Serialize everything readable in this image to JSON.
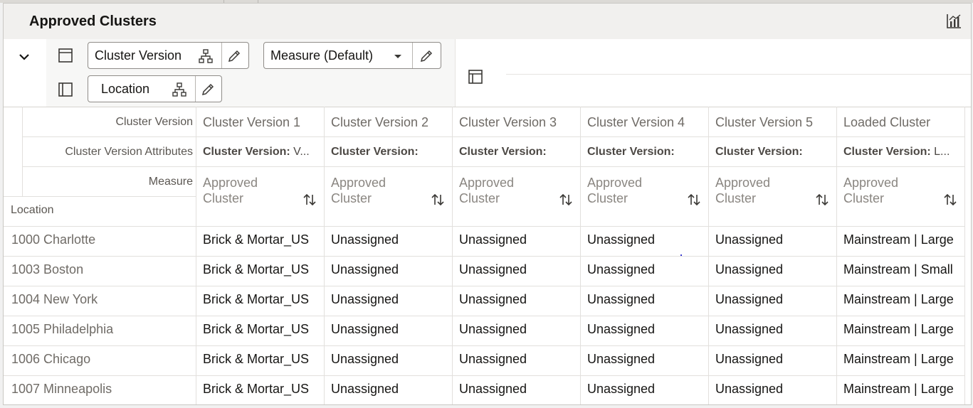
{
  "title": "Approved Clusters",
  "pivot": {
    "columns_chips": [
      {
        "label": "Cluster Version",
        "kind": "hierarchy"
      },
      {
        "label": "Measure (Default)",
        "kind": "dropdown"
      }
    ],
    "rows_chips": [
      {
        "label": "Location",
        "kind": "hierarchy"
      }
    ]
  },
  "grid": {
    "header_labels": {
      "cluster_version": "Cluster Version",
      "attributes": "Cluster Version Attributes",
      "measure": "Measure",
      "location": "Location"
    },
    "columns": [
      {
        "name": "Cluster Version 1",
        "attr_key": "Cluster Version:",
        "attr_val": " V...",
        "measure_line1": "Approved",
        "measure_line2": "Cluster"
      },
      {
        "name": "Cluster Version 2",
        "attr_key": "Cluster Version:",
        "attr_val": "",
        "measure_line1": "Approved",
        "measure_line2": "Cluster"
      },
      {
        "name": "Cluster Version 3",
        "attr_key": "Cluster Version:",
        "attr_val": "",
        "measure_line1": "Approved",
        "measure_line2": "Cluster"
      },
      {
        "name": "Cluster Version 4",
        "attr_key": "Cluster Version:",
        "attr_val": "",
        "measure_line1": "Approved",
        "measure_line2": "Cluster"
      },
      {
        "name": "Cluster Version 5",
        "attr_key": "Cluster Version:",
        "attr_val": "",
        "measure_line1": "Approved",
        "measure_line2": "Cluster"
      },
      {
        "name": "Loaded Cluster",
        "attr_key": "Cluster Version:",
        "attr_val": " L...",
        "measure_line1": "Approved",
        "measure_line2": "Cluster"
      }
    ],
    "rows": [
      {
        "location": "1000 Charlotte",
        "cells": [
          "Brick & Mortar_US",
          "Unassigned",
          "Unassigned",
          "Unassigned",
          "Unassigned",
          "Mainstream | Large"
        ]
      },
      {
        "location": "1003 Boston",
        "cells": [
          "Brick & Mortar_US",
          "Unassigned",
          "Unassigned",
          "Unassigned",
          "Unassigned",
          "Mainstream | Small"
        ]
      },
      {
        "location": "1004 New York",
        "cells": [
          "Brick & Mortar_US",
          "Unassigned",
          "Unassigned",
          "Unassigned",
          "Unassigned",
          "Mainstream | Large"
        ]
      },
      {
        "location": "1005 Philadelphia",
        "cells": [
          "Brick & Mortar_US",
          "Unassigned",
          "Unassigned",
          "Unassigned",
          "Unassigned",
          "Mainstream | Large"
        ]
      },
      {
        "location": "1006 Chicago",
        "cells": [
          "Brick & Mortar_US",
          "Unassigned",
          "Unassigned",
          "Unassigned",
          "Unassigned",
          "Mainstream | Large"
        ]
      },
      {
        "location": "1007 Minneapolis",
        "cells": [
          "Brick & Mortar_US",
          "Unassigned",
          "Unassigned",
          "Unassigned",
          "Unassigned",
          "Mainstream | Large"
        ]
      }
    ]
  },
  "icons": {
    "chart": "chart-icon",
    "collapse": "chevron-down-icon",
    "columns_area": "columns-layout-icon",
    "rows_area": "rows-layout-icon",
    "hierarchy": "hierarchy-icon",
    "edit": "pencil-icon",
    "dropdown": "caret-down-icon",
    "filter_panel": "panel-icon",
    "sort": "sort-icon"
  }
}
